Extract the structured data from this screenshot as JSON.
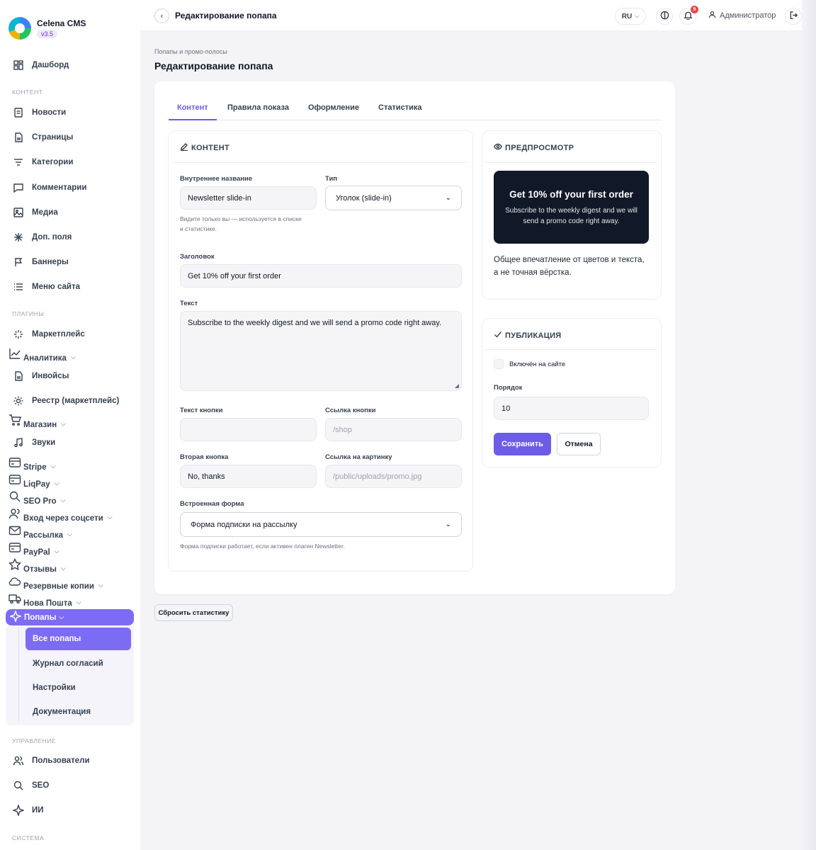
{
  "app": {
    "name": "Celena CMS",
    "version": "v3.5"
  },
  "sidebar": {
    "dashboard": "Дашборд",
    "sections": {
      "content": "КОНТЕНТ",
      "plugins": "ПЛАГИНЫ",
      "management": "УПРАВЛЕНИЕ",
      "system": "СИСТЕМА"
    },
    "content_items": [
      "Новости",
      "Страницы",
      "Категории",
      "Комментарии",
      "Медиа",
      "Доп. поля",
      "Баннеры",
      "Меню сайта"
    ],
    "plugin_items": {
      "marketplace": "Маркетплейс",
      "analytics": "Аналитика",
      "invoices": "Инвойсы",
      "registry": "Реестр (маркетплейс)",
      "shop": "Магазин",
      "sounds": "Звуки",
      "stripe": "Stripe",
      "liqpay": "LiqPay",
      "seopro": "SEO Pro",
      "social_login": "Вход через соцсети",
      "mailing": "Рассылка",
      "paypal": "PayPal",
      "reviews": "Отзывы",
      "backups": "Резервные копии",
      "nova_poshta": "Нова Пошта",
      "popups": "Попапы"
    },
    "popups_sub": [
      "Все попапы",
      "Журнал согласий",
      "Настройки",
      "Документация"
    ],
    "management_items": [
      "Пользователи",
      "SEO",
      "ИИ"
    ]
  },
  "topbar": {
    "back": "‹",
    "title": "Редактирование попапа",
    "lang": "RU",
    "notifications": "9",
    "user": "Администратор"
  },
  "page": {
    "breadcrumb": "Попапы и промо-полосы",
    "title": "Редактирование попапа",
    "tabs": [
      "Контент",
      "Правила показа",
      "Оформление",
      "Статистика"
    ]
  },
  "content_panel": {
    "heading": "КОНТЕНТ",
    "internal_name_label": "Внутреннее название",
    "internal_name_value": "Newsletter slide-in",
    "internal_name_hint_1": "Видите только вы — используется в списке",
    "internal_name_hint_2": "и статистике.",
    "type_label": "Тип",
    "type_value": "Уголок (slide-in)",
    "heading_label": "Заголовок",
    "heading_value": "Get 10% off your first order",
    "text_label": "Текст",
    "text_value": "Subscribe to the weekly digest and we will send a promo code right away.",
    "button_text_label": "Текст кнопки",
    "button_text_value": "",
    "button_link_label": "Ссылка кнопки",
    "button_link_placeholder": "/shop",
    "second_button_label": "Вторая кнопка",
    "second_button_value": "No, thanks",
    "image_link_label": "Ссылка на картинку",
    "image_link_placeholder": "/public/uploads/promo.jpg",
    "embedded_form_label": "Встроенная форма",
    "embedded_form_value": "Форма подписки на рассылку",
    "embedded_form_hint": "Форма подписки работает, если активен плагин Newsletter."
  },
  "preview_panel": {
    "heading": "ПРЕДПРОСМОТР",
    "popup_title": "Get 10% off your first order",
    "popup_text": "Subscribe to the weekly digest and we will send a promo code right away.",
    "note": "Общее впечатление от цветов и текста, а не точная вёрстка."
  },
  "publish_panel": {
    "heading": "ПУБЛИКАЦИЯ",
    "enabled_label": "Включён на сайте",
    "enabled": false,
    "order_label": "Порядок",
    "order_value": "10",
    "save": "Сохранить",
    "cancel": "Отмена"
  },
  "reset_stats": "Сбросить статистику",
  "colors": {
    "accent": "#6d5ce7",
    "sidebar_active": "#7c6cf4",
    "preview_bg": "#111827",
    "badge": "#ef4444"
  }
}
